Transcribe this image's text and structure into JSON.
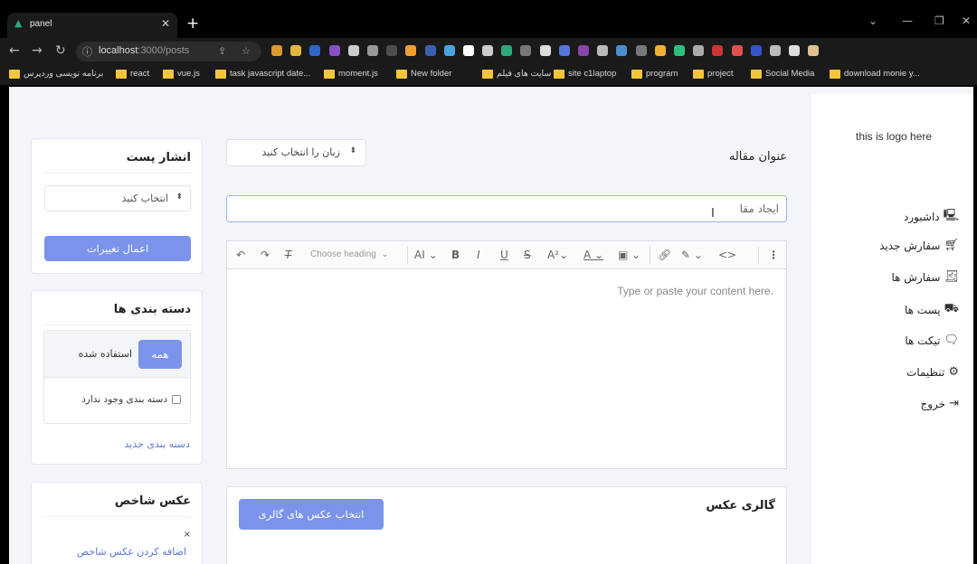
{
  "browser": {
    "tab_title": "panel",
    "url_host": "localhost",
    "url_rest": ":3000/posts",
    "bookmarks": [
      {
        "label": "برنامه نویسی وردپرس"
      },
      {
        "label": "react"
      },
      {
        "label": "vue.js"
      },
      {
        "label": "task javascript date..."
      },
      {
        "label": "moment.js"
      },
      {
        "label": "New folder"
      },
      {
        "label": "سایت های فیلم"
      },
      {
        "label": "site c1laptop"
      },
      {
        "label": "program"
      },
      {
        "label": "project"
      },
      {
        "label": "Social Media"
      },
      {
        "label": "download monie y..."
      }
    ],
    "extension_colors": [
      "#d99a2b",
      "#e5b640",
      "#2e65c8",
      "#8a4fc8",
      "#cccccc",
      "#999999",
      "#4d4d4d",
      "#f0a030",
      "#3b5fb0",
      "#4aa3df",
      "#ffffff",
      "#cccccc",
      "#2ea87a",
      "#777777",
      "#dddddd",
      "#5577dd",
      "#8844aa",
      "#bbbbbb",
      "#4a8fd0",
      "#777777",
      "#f0b030",
      "#2ec07a",
      "#aaaaaa",
      "#cc3333",
      "#e05050",
      "#3355cc",
      "#bbbbbb",
      "#dddddd",
      "#e0c090"
    ]
  },
  "sidebar": {
    "logo": "this is logo here",
    "items": [
      {
        "label": "داشبورد",
        "icon": "monitor-icon"
      },
      {
        "label": "سفارش جدید",
        "icon": "cart-icon"
      },
      {
        "label": "سفارش ها",
        "icon": "receipt-icon"
      },
      {
        "label": "پست ها",
        "icon": "truck-icon"
      },
      {
        "label": "تیکت ها",
        "icon": "chat-icon"
      },
      {
        "label": "تنظیمات",
        "icon": "gear-icon"
      },
      {
        "label": "خروج",
        "icon": "logout-icon"
      }
    ]
  },
  "main": {
    "title_label": "عنوان مقاله",
    "language_select": "زبان را انتخاب کنید",
    "title_input_value": "ایجاد مقا",
    "editor": {
      "heading_dropdown": "Choose heading",
      "placeholder": "Type or paste your content here."
    },
    "gallery": {
      "label": "گالری عکس",
      "button": "انتخاب عکس های گالری"
    }
  },
  "publish": {
    "title": "انشار پست",
    "select": "انتخاب کنید",
    "apply_button": "اعمال تغییرات"
  },
  "categories": {
    "title": "دسته بندی ها",
    "tab_all": "همه",
    "tab_used": "استفاده شده",
    "empty_checkbox": "دسته بندی وجود ندارد",
    "new_link": "دسته بندی جدید"
  },
  "featured_image": {
    "title": "عکس شاخص",
    "close": "×",
    "add_link": "اضافه کردن عکس شاخص"
  }
}
